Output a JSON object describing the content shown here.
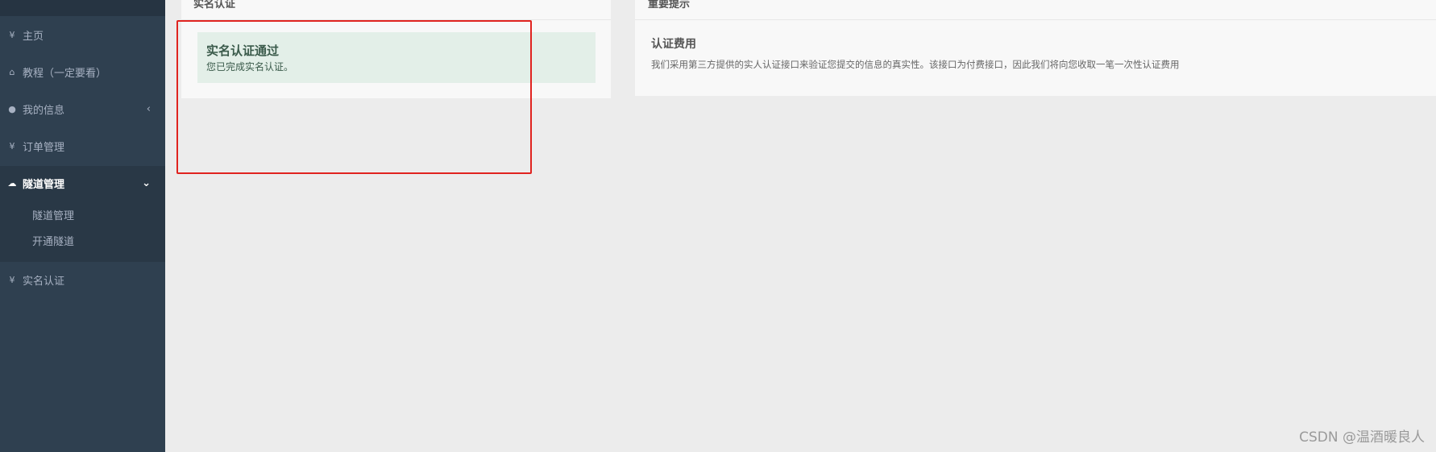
{
  "sidebar": {
    "items": [
      {
        "icon": "yen-icon",
        "glyph": "¥",
        "label": "主页"
      },
      {
        "icon": "home-icon",
        "glyph": "⌂",
        "label": "教程（一定要看）"
      },
      {
        "icon": "user-icon",
        "glyph": "●",
        "label": "我的信息",
        "arrow": "‹"
      },
      {
        "icon": "yen-icon",
        "glyph": "¥",
        "label": "订单管理"
      },
      {
        "icon": "cloud-icon",
        "glyph": "☁",
        "label": "隧道管理",
        "arrow": "⌄"
      },
      {
        "icon": "yen-icon",
        "glyph": "¥",
        "label": "实名认证"
      }
    ],
    "subitems": [
      "隧道管理",
      "开通隧道"
    ]
  },
  "left_panel": {
    "title": "实名认证",
    "success_title": "实名认证通过",
    "success_text": "您已完成实名认证。"
  },
  "right_panel": {
    "title": "重要提示",
    "fee_title": "认证费用",
    "fee_text": "我们采用第三方提供的实人认证接口来验证您提交的信息的真实性。该接口为付费接口，因此我们将向您收取一笔一次性认证费用"
  },
  "watermark": "CSDN @温酒暖良人",
  "colors": {
    "sidebar": "#2f4050",
    "highlight_box": "#e0231f",
    "success_bg": "#e3efe8"
  }
}
